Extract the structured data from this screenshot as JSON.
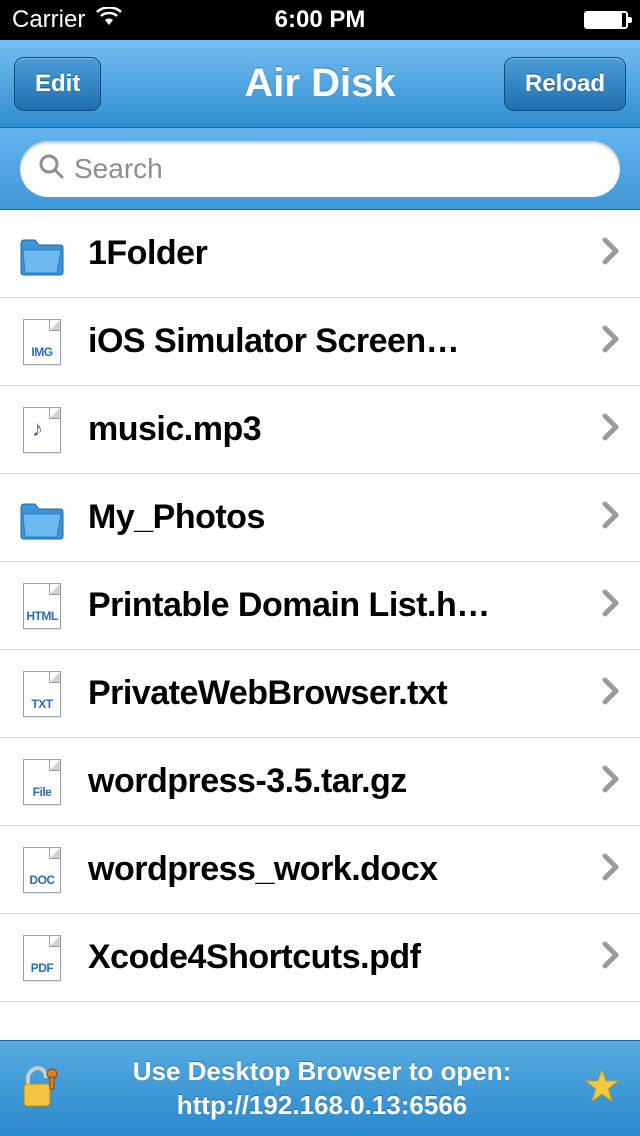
{
  "status": {
    "carrier": "Carrier",
    "time": "6:00 PM"
  },
  "nav": {
    "title": "Air Disk",
    "edit_label": "Edit",
    "reload_label": "Reload"
  },
  "search": {
    "placeholder": "Search"
  },
  "files": [
    {
      "name": "1Folder",
      "type": "folder"
    },
    {
      "name": "iOS Simulator Screen…",
      "type": "img"
    },
    {
      "name": "music.mp3",
      "type": "audio"
    },
    {
      "name": "My_Photos",
      "type": "folder"
    },
    {
      "name": "Printable Domain List.h…",
      "type": "html"
    },
    {
      "name": "PrivateWebBrowser.txt",
      "type": "txt"
    },
    {
      "name": "wordpress-3.5.tar.gz",
      "type": "file"
    },
    {
      "name": "wordpress_work.docx",
      "type": "doc"
    },
    {
      "name": "Xcode4Shortcuts.pdf",
      "type": "pdf"
    }
  ],
  "file_tags": {
    "img": "IMG",
    "html": "HTML",
    "txt": "TXT",
    "file": "File",
    "doc": "DOC",
    "pdf": "PDF"
  },
  "bottom": {
    "line1": "Use Desktop Browser to open:",
    "line2": "http://192.168.0.13:6566"
  }
}
